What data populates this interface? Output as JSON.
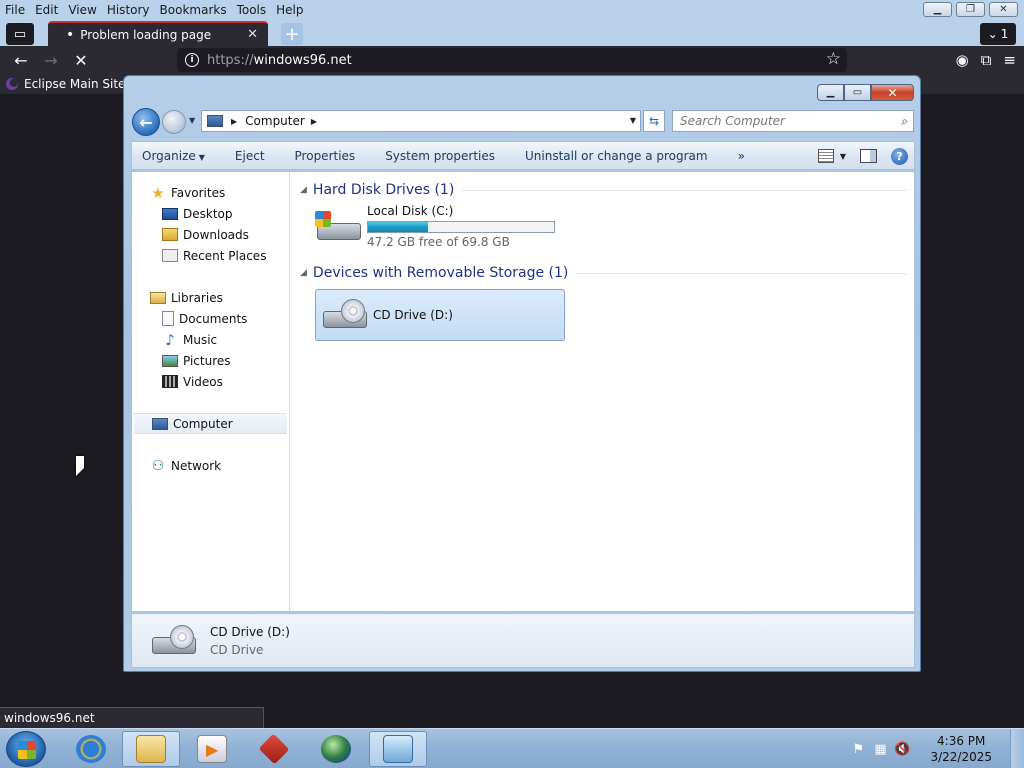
{
  "browser": {
    "menu": [
      "File",
      "Edit",
      "View",
      "History",
      "Bookmarks",
      "Tools",
      "Help"
    ],
    "tab_title": "Problem loading page",
    "tab_count": "1",
    "url_protocol": "https://",
    "url_host": "windows96.net",
    "bookmark": "Eclipse Main Site",
    "status_text": "windows96.net"
  },
  "explorer": {
    "breadcrumb": "Computer",
    "search_placeholder": "Search Computer",
    "commands": [
      "Organize",
      "Eject",
      "Properties",
      "System properties",
      "Uninstall or change a program"
    ],
    "more": "»",
    "nav": {
      "favorites": "Favorites",
      "desktop": "Desktop",
      "downloads": "Downloads",
      "recent": "Recent Places",
      "libraries": "Libraries",
      "documents": "Documents",
      "music": "Music",
      "pictures": "Pictures",
      "videos": "Videos",
      "computer": "Computer",
      "network": "Network"
    },
    "groups": {
      "hdd": "Hard Disk Drives (1)",
      "removable": "Devices with Removable Storage (1)"
    },
    "local_disk": {
      "name": "Local Disk (C:)",
      "free": "47.2 GB free of 69.8 GB",
      "used_fraction": 0.324
    },
    "cd_drive": {
      "name": "CD Drive (D:)",
      "type": "CD Drive"
    }
  },
  "taskbar": {
    "time": "4:36 PM",
    "date": "3/22/2025"
  }
}
